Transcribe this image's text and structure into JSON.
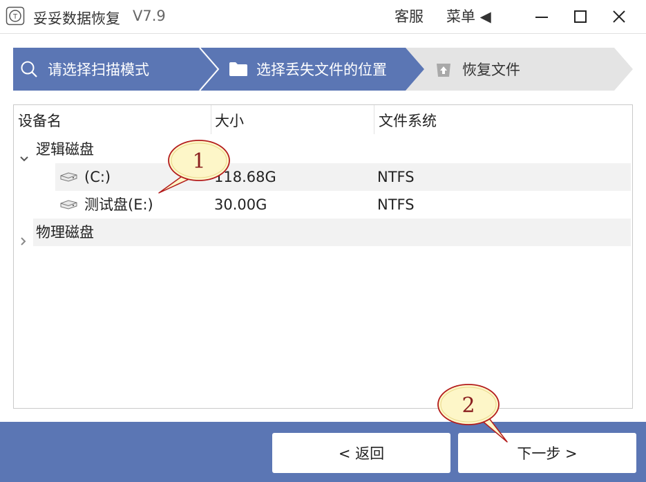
{
  "window": {
    "title": "妥妥数据恢复",
    "version": "V7.9",
    "service_label": "客服",
    "menu_label": "菜单 ◀",
    "minimize_icon": "minimize-icon",
    "maximize_icon": "maximize-icon",
    "close_icon": "close-icon"
  },
  "steps": [
    {
      "label": "请选择扫描模式",
      "icon": "search-icon",
      "state": "done"
    },
    {
      "label": "选择丢失文件的位置",
      "icon": "folder-icon",
      "state": "active"
    },
    {
      "label": "恢复文件",
      "icon": "restore-icon",
      "state": "pending"
    }
  ],
  "table": {
    "columns": [
      "设备名",
      "大小",
      "文件系统"
    ],
    "groups": [
      {
        "label": "逻辑磁盘",
        "expanded": true,
        "items": [
          {
            "name": "(C:)",
            "size": "118.68G",
            "fs": "NTFS",
            "icon": "drive-icon"
          },
          {
            "name": "测试盘(E:)",
            "size": "30.00G",
            "fs": "NTFS",
            "icon": "drive-icon"
          }
        ]
      },
      {
        "label": "物理磁盘",
        "expanded": false,
        "items": []
      }
    ]
  },
  "buttons": {
    "back_label": "< 返回",
    "next_label": "下一步 >"
  },
  "callouts": [
    "1",
    "2"
  ],
  "colors": {
    "accent": "#5b76b4",
    "step_pending": "#e4e4e4",
    "row_shade": "#f2f2f2",
    "callout_fill": "#fdf6c8",
    "callout_stroke": "#b31b1b"
  }
}
